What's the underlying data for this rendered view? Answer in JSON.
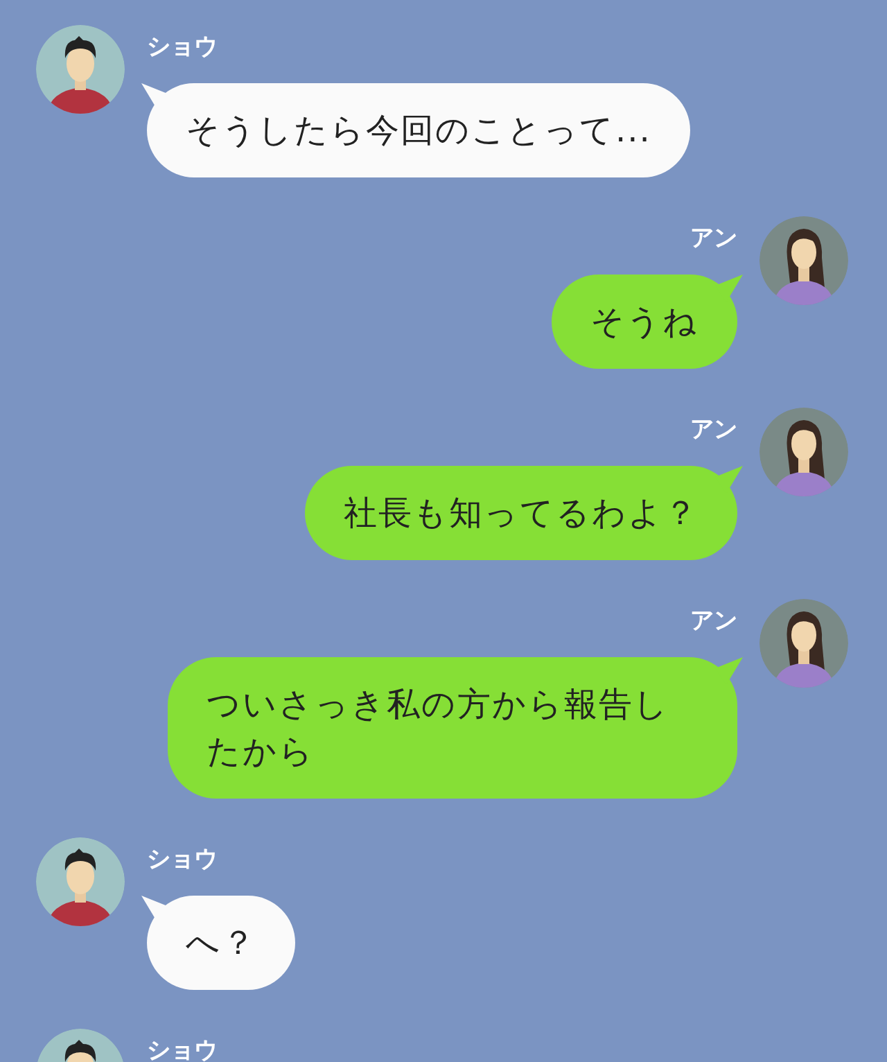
{
  "messages": [
    {
      "kind": "incoming",
      "sender": "ショウ",
      "text": "そうしたら今回のことって..."
    },
    {
      "kind": "outgoing",
      "sender": "アン",
      "text": "そうね"
    },
    {
      "kind": "outgoing",
      "sender": "アン",
      "text": "社長も知ってるわよ？"
    },
    {
      "kind": "outgoing",
      "sender": "アン",
      "text": "ついさっき私の方から報告したから"
    },
    {
      "kind": "incoming",
      "sender": "ショウ",
      "text": "へ？"
    },
    {
      "kind": "incoming",
      "sender": "ショウ"
    }
  ]
}
